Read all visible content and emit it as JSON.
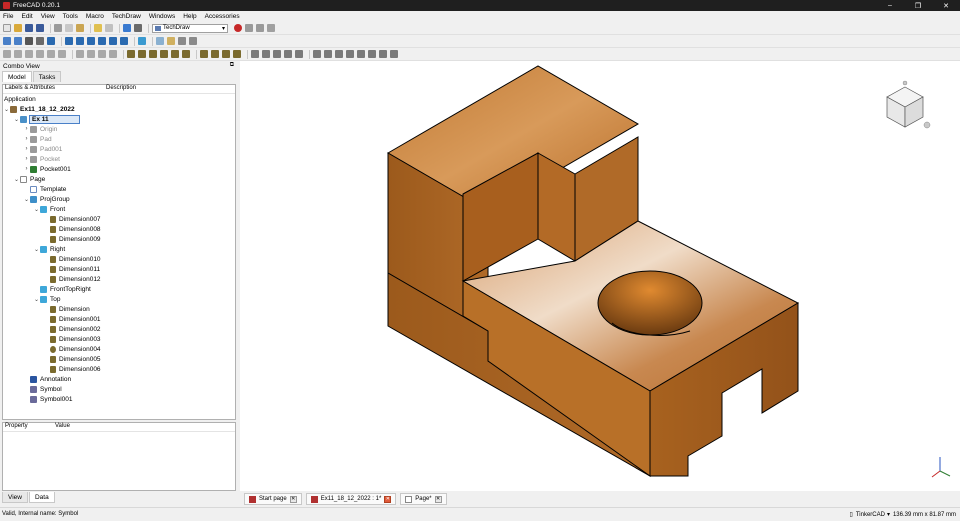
{
  "window": {
    "title": "FreeCAD 0.20.1",
    "minimize": "–",
    "maximize": "❐",
    "close": "✕"
  },
  "menu": [
    "File",
    "Edit",
    "View",
    "Tools",
    "Macro",
    "TechDraw",
    "Windows",
    "Help",
    "Accessories"
  ],
  "workbench": "TechDraw",
  "combo_view": {
    "title": "Combo View",
    "tabs": [
      "Model",
      "Tasks"
    ],
    "tree_columns": [
      "Labels & Attributes",
      "Description"
    ],
    "application_label": "Application",
    "tree": [
      {
        "label": "Ex11_18_12_2022",
        "icon": "document-icon"
      },
      {
        "label": "Ex 11",
        "icon": "body-icon",
        "selected": true
      },
      {
        "label": "Origin",
        "icon": "origin-icon"
      },
      {
        "label": "Pad",
        "icon": "pad-icon"
      },
      {
        "label": "Pad001",
        "icon": "pad-icon"
      },
      {
        "label": "Pocket",
        "icon": "pocket-icon"
      },
      {
        "label": "Pocket001",
        "icon": "pocket-icon"
      },
      {
        "label": "Page",
        "icon": "page-icon"
      },
      {
        "label": "Template",
        "icon": "template-icon"
      },
      {
        "label": "ProjGroup",
        "icon": "projgroup-icon"
      },
      {
        "label": "Front",
        "icon": "view-icon"
      },
      {
        "label": "Dimension007",
        "icon": "dimension-horizontal-icon"
      },
      {
        "label": "Dimension008",
        "icon": "dimension-vertical-icon"
      },
      {
        "label": "Dimension009",
        "icon": "dimension-vertical-icon"
      },
      {
        "label": "Right",
        "icon": "view-icon"
      },
      {
        "label": "Dimension010",
        "icon": "dimension-horizontal-icon"
      },
      {
        "label": "Dimension011",
        "icon": "dimension-horizontal-icon"
      },
      {
        "label": "Dimension012",
        "icon": "dimension-horizontal-icon"
      },
      {
        "label": "FrontTopRight",
        "icon": "view-icon"
      },
      {
        "label": "Top",
        "icon": "view-icon"
      },
      {
        "label": "Dimension",
        "icon": "dimension-horizontal-icon"
      },
      {
        "label": "Dimension001",
        "icon": "dimension-horizontal-icon"
      },
      {
        "label": "Dimension002",
        "icon": "dimension-horizontal-icon"
      },
      {
        "label": "Dimension003",
        "icon": "dimension-vertical-icon"
      },
      {
        "label": "Dimension004",
        "icon": "dimension-diameter-icon"
      },
      {
        "label": "Dimension005",
        "icon": "dimension-horizontal-icon"
      },
      {
        "label": "Dimension006",
        "icon": "dimension-horizontal-icon"
      },
      {
        "label": "Annotation",
        "icon": "annotation-icon"
      },
      {
        "label": "Symbol",
        "icon": "symbol-icon"
      },
      {
        "label": "Symbol001",
        "icon": "symbol-icon"
      }
    ],
    "property_columns": [
      "Property",
      "Value"
    ],
    "property_tabs": [
      "View",
      "Data"
    ]
  },
  "document_tabs": [
    {
      "label": "Start page"
    },
    {
      "label": "Ex11_18_12_2022 : 1*"
    },
    {
      "label": "Page*"
    }
  ],
  "status": {
    "message": "Valid, Internal name: Symbol",
    "navigation": "TinkerCAD",
    "dimensions": "136.39 mm x 81.87 mm"
  },
  "colors": {
    "wood": "#a8611f",
    "wood_dark": "#7a4210",
    "selection": "#4a80c8"
  }
}
